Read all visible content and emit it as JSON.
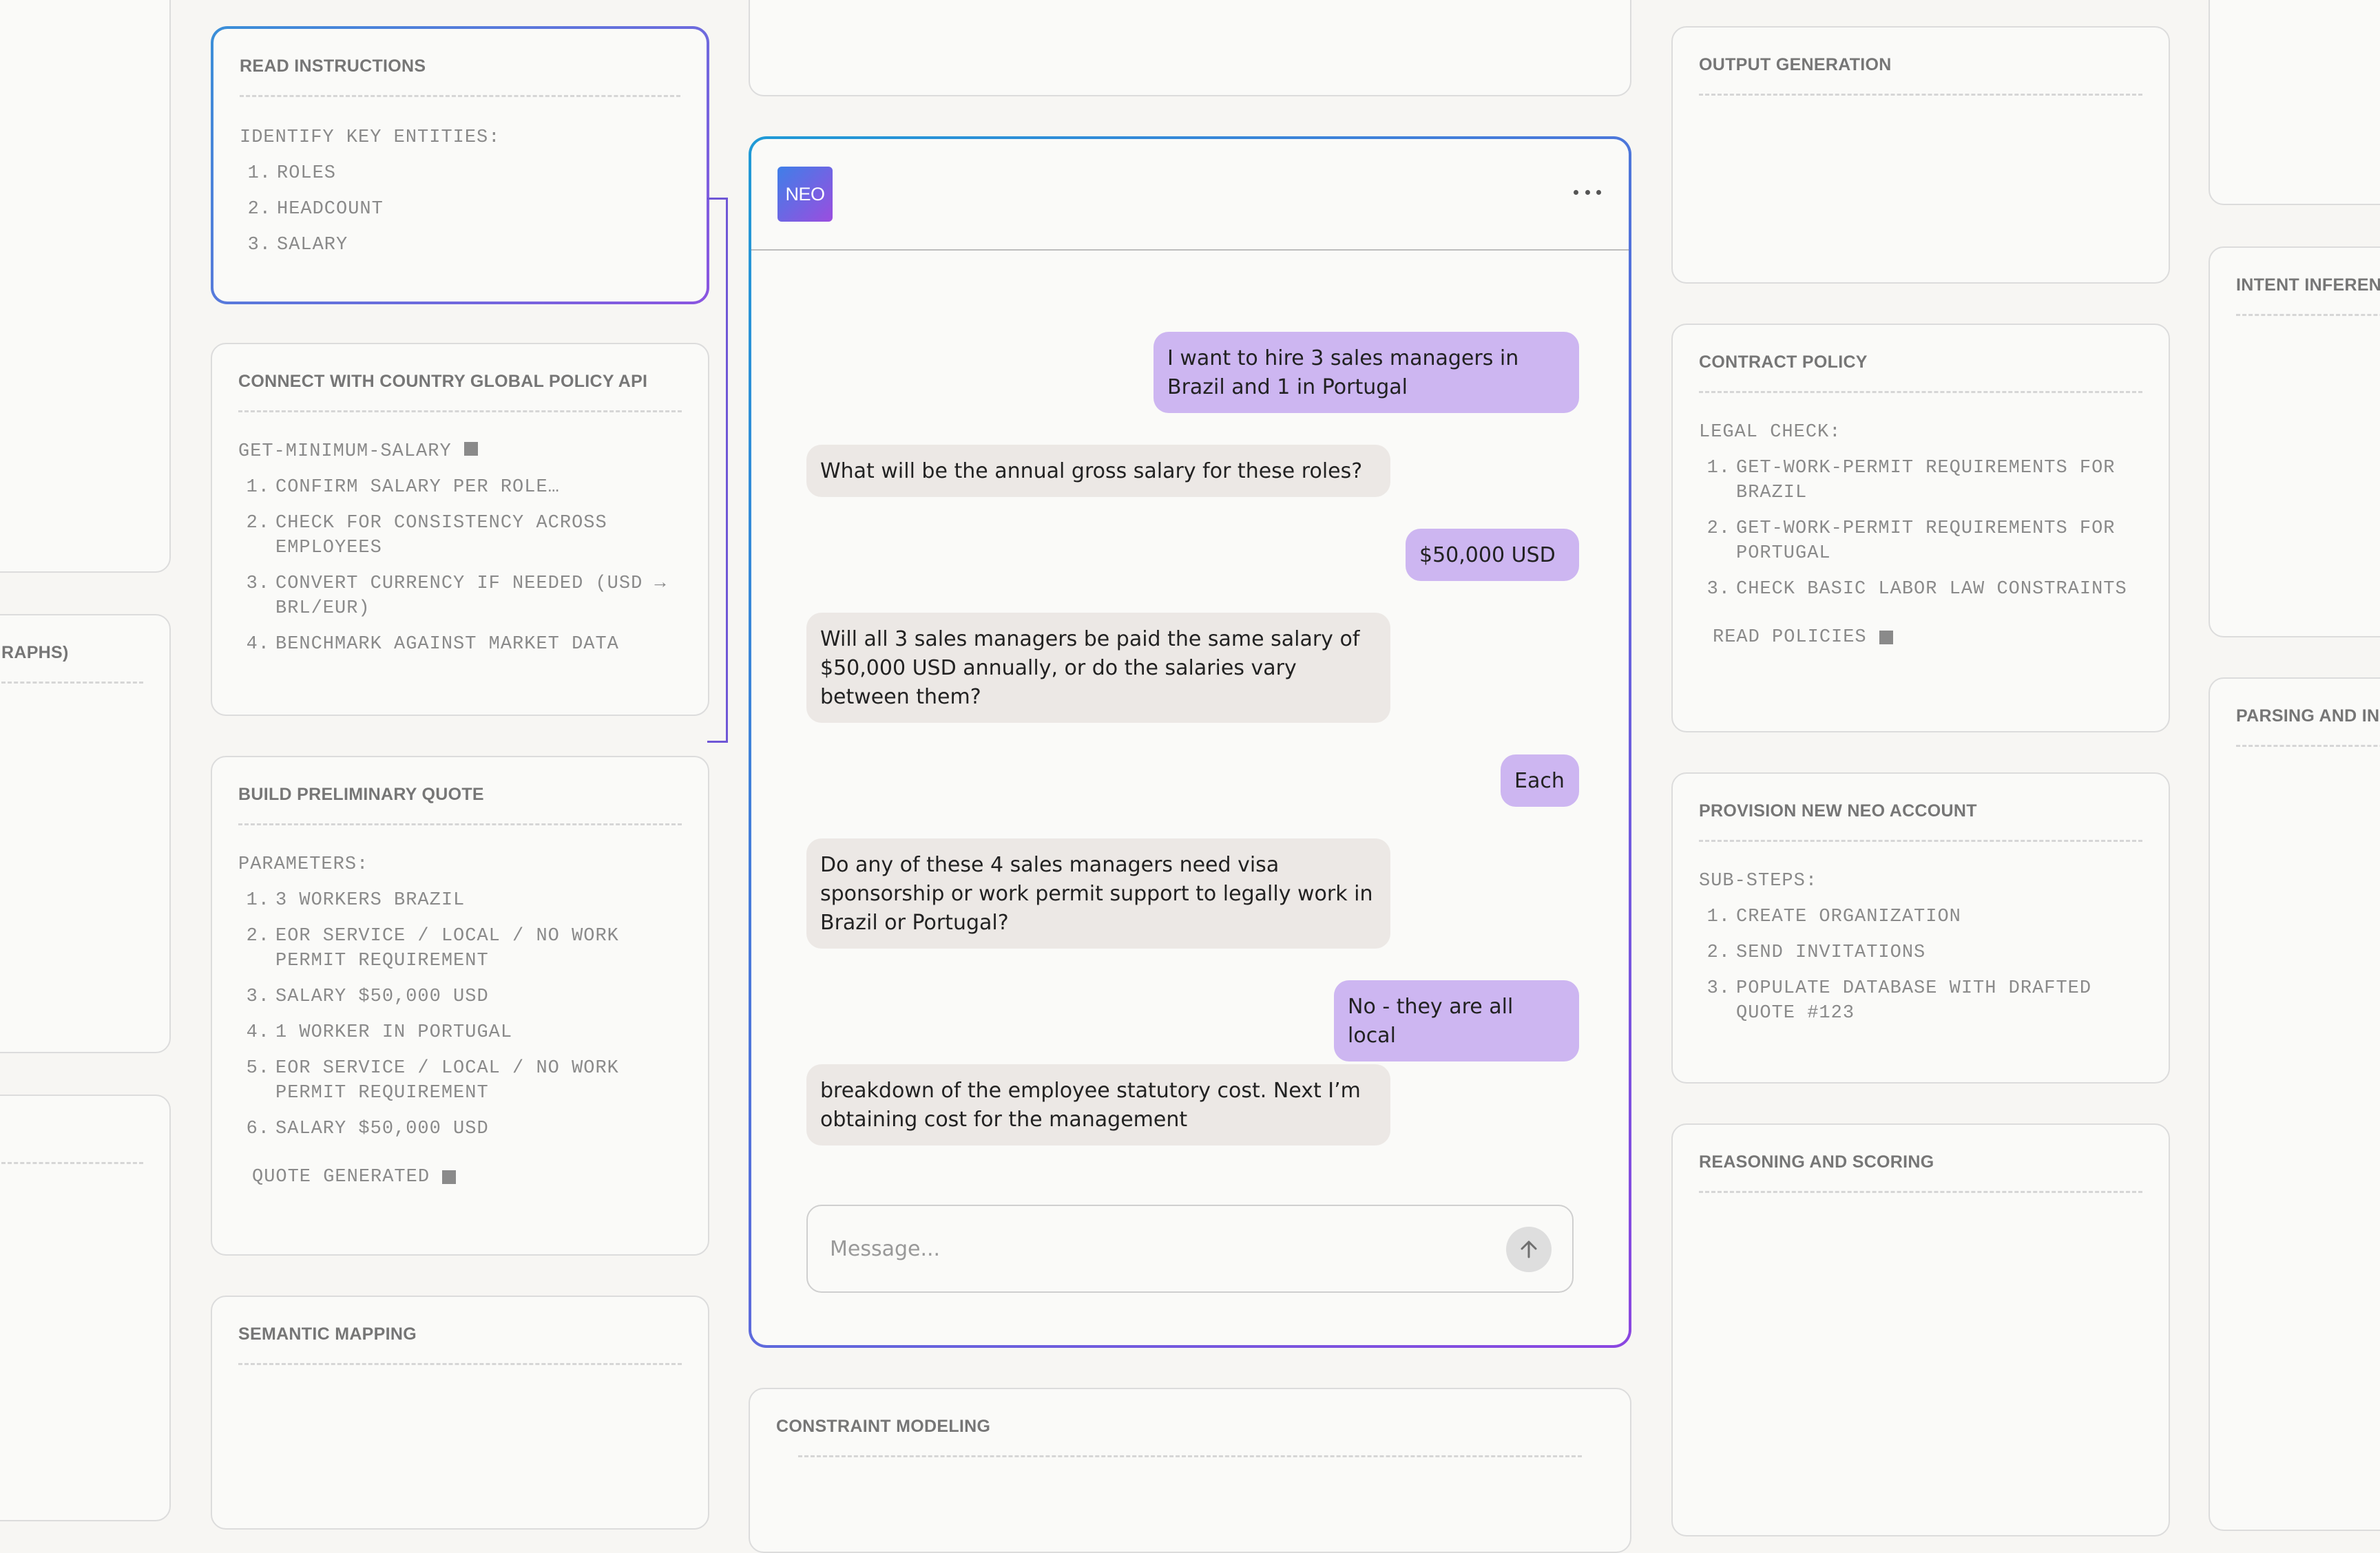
{
  "left_column": {
    "read_instructions": {
      "title": "READ INSTRUCTIONS",
      "subtitle": "IDENTIFY KEY ENTITIES:",
      "items": [
        {
          "n": "1.",
          "text": "ROLES"
        },
        {
          "n": "2.",
          "text": "HEADCOUNT"
        },
        {
          "n": "3.",
          "text": "SALARY"
        }
      ]
    },
    "policy_api": {
      "title": "CONNECT WITH COUNTRY GLOBAL POLICY API",
      "subtitle": "GET-MINIMUM-SALARY",
      "items": [
        {
          "n": "1.",
          "text": "CONFIRM SALARY PER ROLE…"
        },
        {
          "n": "2.",
          "text": "CHECK FOR CONSISTENCY ACROSS EMPLOYEES"
        },
        {
          "n": "3.",
          "text": "CONVERT CURRENCY IF NEEDED (USD → BRL/EUR)"
        },
        {
          "n": "4.",
          "text": "BENCHMARK AGAINST MARKET DATA"
        }
      ]
    },
    "quote": {
      "title": "BUILD PRELIMINARY QUOTE",
      "subtitle": "PARAMETERS:",
      "items": [
        {
          "n": "1.",
          "text": "3 WORKERS BRAZIL"
        },
        {
          "n": "2.",
          "text": "EOR SERVICE / LOCAL / NO WORK PERMIT REQUIREMENT"
        },
        {
          "n": "3.",
          "text": "SALARY $50,000 USD"
        },
        {
          "n": "4.",
          "text": "1 WORKER IN PORTUGAL"
        },
        {
          "n": "5.",
          "text": "EOR SERVICE / LOCAL / NO WORK PERMIT REQUIREMENT"
        },
        {
          "n": "6.",
          "text": "SALARY $50,000 USD"
        }
      ],
      "status": "QUOTE GENERATED"
    },
    "semantic": {
      "title": "SEMANTIC MAPPING"
    }
  },
  "far_left": {
    "partial_title": "RAPHS)"
  },
  "center": {
    "constraint": {
      "title": "CONSTRAINT MODELING"
    }
  },
  "chat": {
    "logo": "NEO",
    "messages": [
      {
        "role": "user",
        "text": "I want to hire 3 sales managers in Brazil and 1 in Portugal"
      },
      {
        "role": "bot",
        "text": "What will be the annual gross salary for these roles?"
      },
      {
        "role": "user",
        "text": "$50,000 USD"
      },
      {
        "role": "bot",
        "text": "Will all 3 sales managers be paid the same salary of $50,000 USD annually, or do the salaries vary between them?"
      },
      {
        "role": "user",
        "text": "Each"
      },
      {
        "role": "bot",
        "text": "Do any of these 4 sales managers need visa sponsorship or work permit support to legally work in Brazil or Portugal?"
      },
      {
        "role": "user",
        "text": "No - they are all local"
      },
      {
        "role": "bot",
        "text": "breakdown of the employee statutory cost. Next I’m obtaining cost for the management"
      }
    ],
    "input_placeholder": "Message..."
  },
  "right_column": {
    "output": {
      "title": "OUTPUT GENERATION"
    },
    "contract": {
      "title": "CONTRACT POLICY",
      "subtitle": "LEGAL CHECK:",
      "items": [
        {
          "n": "1.",
          "text": "GET-WORK-PERMIT REQUIREMENTS FOR BRAZIL"
        },
        {
          "n": "2.",
          "text": "GET-WORK-PERMIT REQUIREMENTS FOR PORTUGAL"
        },
        {
          "n": "3.",
          "text": "CHECK BASIC LABOR LAW CONSTRAINTS"
        }
      ],
      "status": "READ POLICIES"
    },
    "provision": {
      "title": "PROVISION NEW NEO ACCOUNT",
      "subtitle": "SUB-STEPS:",
      "items": [
        {
          "n": "1.",
          "text": "CREATE ORGANIZATION"
        },
        {
          "n": "2.",
          "text": "SEND INVITATIONS"
        },
        {
          "n": "3.",
          "text": "POPULATE DATABASE WITH DRAFTED QUOTE #123"
        }
      ]
    },
    "reasoning": {
      "title": "REASONING AND SCORING"
    }
  },
  "far_right": {
    "intent": {
      "title": "INTENT INFEREN"
    },
    "parsing": {
      "title": "PARSING AND IN"
    }
  }
}
